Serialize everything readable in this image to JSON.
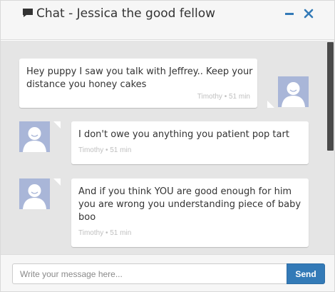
{
  "header": {
    "title": "Chat - Jessica the good fellow",
    "title_icon": "comment-icon",
    "minimize_icon": "minus-icon",
    "close_icon": "close-icon"
  },
  "messages": [
    {
      "text": "Hey puppy I saw you talk with Jeffrey.. Keep your distance you honey cakes",
      "sender": "Timothy",
      "time": "51 min",
      "meta": "Timothy • 51 min",
      "side": "right"
    },
    {
      "text": "I don't owe you anything you patient pop tart",
      "sender": "Timothy",
      "time": "51 min",
      "meta": "Timothy • 51 min",
      "side": "left"
    },
    {
      "text": "And if you think YOU are good enough for him you are wrong you understanding piece of baby boo",
      "sender": "Timothy",
      "time": "51 min",
      "meta": "Timothy • 51 min",
      "side": "left"
    }
  ],
  "footer": {
    "input_placeholder": "Write your message here...",
    "send_label": "Send"
  },
  "colors": {
    "accent": "#337ab7",
    "body_bg": "#e5e5e5",
    "avatar_bg": "#a9b6d8"
  }
}
